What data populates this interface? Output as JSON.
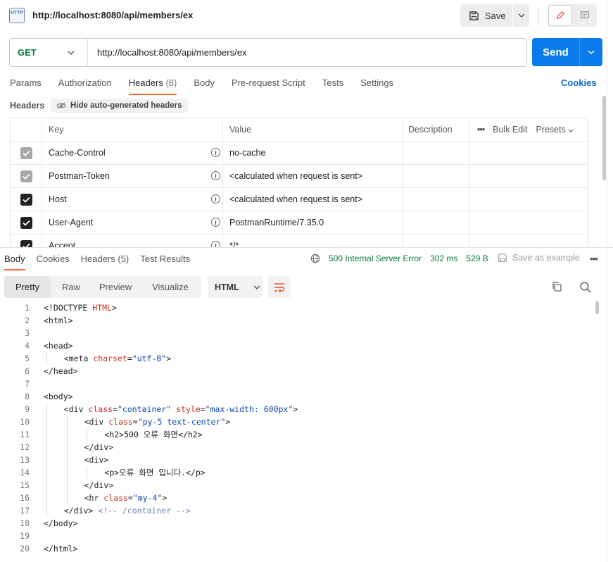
{
  "request": {
    "title": "http://localhost:8080/api/members/ex",
    "icon_text": "HTTP",
    "save_label": "Save",
    "method": "GET",
    "url": "http://localhost:8080/api/members/ex",
    "send_label": "Send"
  },
  "request_tabs": [
    {
      "label": "Params",
      "count": ""
    },
    {
      "label": "Authorization",
      "count": ""
    },
    {
      "label": "Headers",
      "count": "(8)"
    },
    {
      "label": "Body",
      "count": ""
    },
    {
      "label": "Pre-request Script",
      "count": ""
    },
    {
      "label": "Tests",
      "count": ""
    },
    {
      "label": "Settings",
      "count": ""
    }
  ],
  "active_request_tab": "Headers",
  "cookies_link": "Cookies",
  "headers_section": {
    "label": "Headers",
    "hide_auto_label": "Hide auto-generated headers",
    "columns": {
      "key": "Key",
      "value": "Value",
      "description": "Description",
      "bulk_edit": "Bulk Edit",
      "presets": "Presets"
    },
    "rows": [
      {
        "checked": true,
        "auto": true,
        "key": "Cache-Control",
        "value": "no-cache"
      },
      {
        "checked": true,
        "auto": true,
        "key": "Postman-Token",
        "value": "<calculated when request is sent>"
      },
      {
        "checked": true,
        "auto": false,
        "key": "Host",
        "value": "<calculated when request is sent>"
      },
      {
        "checked": true,
        "auto": false,
        "key": "User-Agent",
        "value": "PostmanRuntime/7.35.0"
      },
      {
        "checked": true,
        "auto": false,
        "key": "Accept",
        "value": "*/*"
      }
    ]
  },
  "response_tabs": [
    {
      "label": "Body",
      "count": ""
    },
    {
      "label": "Cookies",
      "count": ""
    },
    {
      "label": "Headers",
      "count": "(5)"
    },
    {
      "label": "Test Results",
      "count": ""
    }
  ],
  "active_response_tab": "Body",
  "response_meta": {
    "status": "500 Internal Server Error",
    "time": "302 ms",
    "size": "529 B",
    "save_example": "Save as example",
    "status_color": "#0b7a3e"
  },
  "view_tabs": [
    "Pretty",
    "Raw",
    "Preview",
    "Visualize"
  ],
  "active_view_tab": "Pretty",
  "format": "HTML",
  "code_lines": [
    {
      "n": "1",
      "indent": 0,
      "parts": [
        [
          "tag",
          "<"
        ],
        [
          "tag",
          "!DOCTYPE "
        ],
        [
          "attr",
          "HTML"
        ],
        [
          "tag",
          ">"
        ]
      ]
    },
    {
      "n": "2",
      "indent": 0,
      "parts": [
        [
          "tag",
          "<html>"
        ]
      ]
    },
    {
      "n": "3",
      "indent": 0,
      "parts": []
    },
    {
      "n": "4",
      "indent": 0,
      "parts": [
        [
          "tag",
          "<head>"
        ]
      ]
    },
    {
      "n": "5",
      "indent": 1,
      "parts": [
        [
          "tag",
          "<meta "
        ],
        [
          "attr",
          "charset"
        ],
        [
          "tag",
          "="
        ],
        [
          "str",
          "\"utf-8\""
        ],
        [
          "tag",
          ">"
        ]
      ]
    },
    {
      "n": "6",
      "indent": 0,
      "parts": [
        [
          "tag",
          "</head>"
        ]
      ]
    },
    {
      "n": "7",
      "indent": 0,
      "parts": []
    },
    {
      "n": "8",
      "indent": 0,
      "parts": [
        [
          "tag",
          "<body>"
        ]
      ]
    },
    {
      "n": "9",
      "indent": 1,
      "parts": [
        [
          "tag",
          "<div "
        ],
        [
          "attr",
          "class"
        ],
        [
          "tag",
          "="
        ],
        [
          "str",
          "\"container\""
        ],
        [
          "tag",
          " "
        ],
        [
          "attr",
          "style"
        ],
        [
          "tag",
          "="
        ],
        [
          "str",
          "\"max-width: 600px\""
        ],
        [
          "tag",
          ">"
        ]
      ]
    },
    {
      "n": "10",
      "indent": 2,
      "parts": [
        [
          "tag",
          "<div "
        ],
        [
          "attr",
          "class"
        ],
        [
          "tag",
          "="
        ],
        [
          "str",
          "\"py-5 text-center\""
        ],
        [
          "tag",
          ">"
        ]
      ]
    },
    {
      "n": "11",
      "indent": 3,
      "parts": [
        [
          "tag",
          "<h2>"
        ],
        [
          "text",
          "500 오류 화면"
        ],
        [
          "tag",
          "</h2>"
        ]
      ]
    },
    {
      "n": "12",
      "indent": 2,
      "parts": [
        [
          "tag",
          "</div>"
        ]
      ]
    },
    {
      "n": "13",
      "indent": 2,
      "parts": [
        [
          "tag",
          "<div>"
        ]
      ]
    },
    {
      "n": "14",
      "indent": 3,
      "parts": [
        [
          "tag",
          "<p>"
        ],
        [
          "text",
          "오류 화면 입니다."
        ],
        [
          "tag",
          "</p>"
        ]
      ]
    },
    {
      "n": "15",
      "indent": 2,
      "parts": [
        [
          "tag",
          "</div>"
        ]
      ]
    },
    {
      "n": "16",
      "indent": 2,
      "parts": [
        [
          "tag",
          "<hr "
        ],
        [
          "attr",
          "class"
        ],
        [
          "tag",
          "="
        ],
        [
          "str",
          "\"my-4\""
        ],
        [
          "tag",
          ">"
        ]
      ]
    },
    {
      "n": "17",
      "indent": 1,
      "parts": [
        [
          "tag",
          "</div> "
        ],
        [
          "com",
          "<!-- /container -->"
        ]
      ]
    },
    {
      "n": "18",
      "indent": 0,
      "parts": [
        [
          "tag",
          "</body>"
        ]
      ]
    },
    {
      "n": "19",
      "indent": 0,
      "parts": []
    },
    {
      "n": "20",
      "indent": 0,
      "parts": [
        [
          "tag",
          "</html>"
        ]
      ]
    }
  ],
  "icons": {
    "http": "http-request-icon",
    "save": "floppy-disk-icon",
    "edit": "pencil-icon",
    "docs": "comment-icon",
    "hide": "eye-off-icon",
    "info": "info-icon",
    "globe": "globe-icon",
    "wrap": "text-wrap-icon",
    "copy": "copy-icon",
    "search": "search-icon"
  },
  "colors": {
    "accent": "#ff6c37",
    "send": "#097bed",
    "method_get": "#0b7a3e",
    "link": "#0b6bd1"
  }
}
